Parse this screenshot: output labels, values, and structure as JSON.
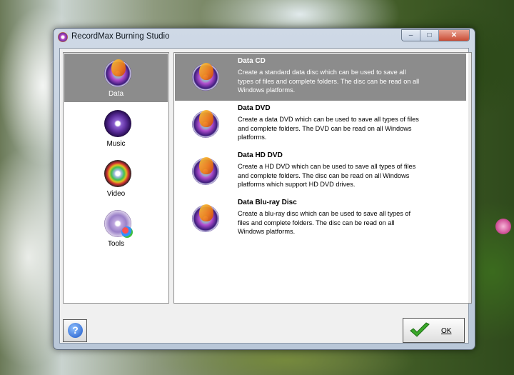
{
  "window": {
    "title": "RecordMax Burning Studio",
    "caption": {
      "minimize": "–",
      "maximize": "□",
      "close": "✕"
    }
  },
  "categories": [
    {
      "label": "Data",
      "icon": "data-disc-icon",
      "selected": true
    },
    {
      "label": "Music",
      "icon": "music-disc-icon",
      "selected": false
    },
    {
      "label": "Video",
      "icon": "video-disc-icon",
      "selected": false
    },
    {
      "label": "Tools",
      "icon": "tools-disc-icon",
      "selected": false
    }
  ],
  "items": [
    {
      "name": "Data CD",
      "description": "Create a standard data disc which can be used to save all types of files and complete folders. The disc can be read on all Windows platforms.",
      "selected": true
    },
    {
      "name": "Data DVD",
      "description": "Create a data DVD which can be used to save all types of files and complete folders. The DVD can be read on all Windows platforms.",
      "selected": false
    },
    {
      "name": "Data HD DVD",
      "description": "Create a HD DVD which can be used to save all types of files and complete folders. The disc can be read on all Windows platforms which support HD DVD drives.",
      "selected": false
    },
    {
      "name": "Data Blu-ray Disc",
      "description": "Create a blu-ray disc which can be used to save all types of files and complete folders. The disc can be read on all Windows platforms.",
      "selected": false
    }
  ],
  "footer": {
    "help_label": "?",
    "ok_label": "OK"
  },
  "colors": {
    "selection": "#8c8c8c",
    "ok_check": "#3aa82a",
    "help": "#1c57c8"
  }
}
